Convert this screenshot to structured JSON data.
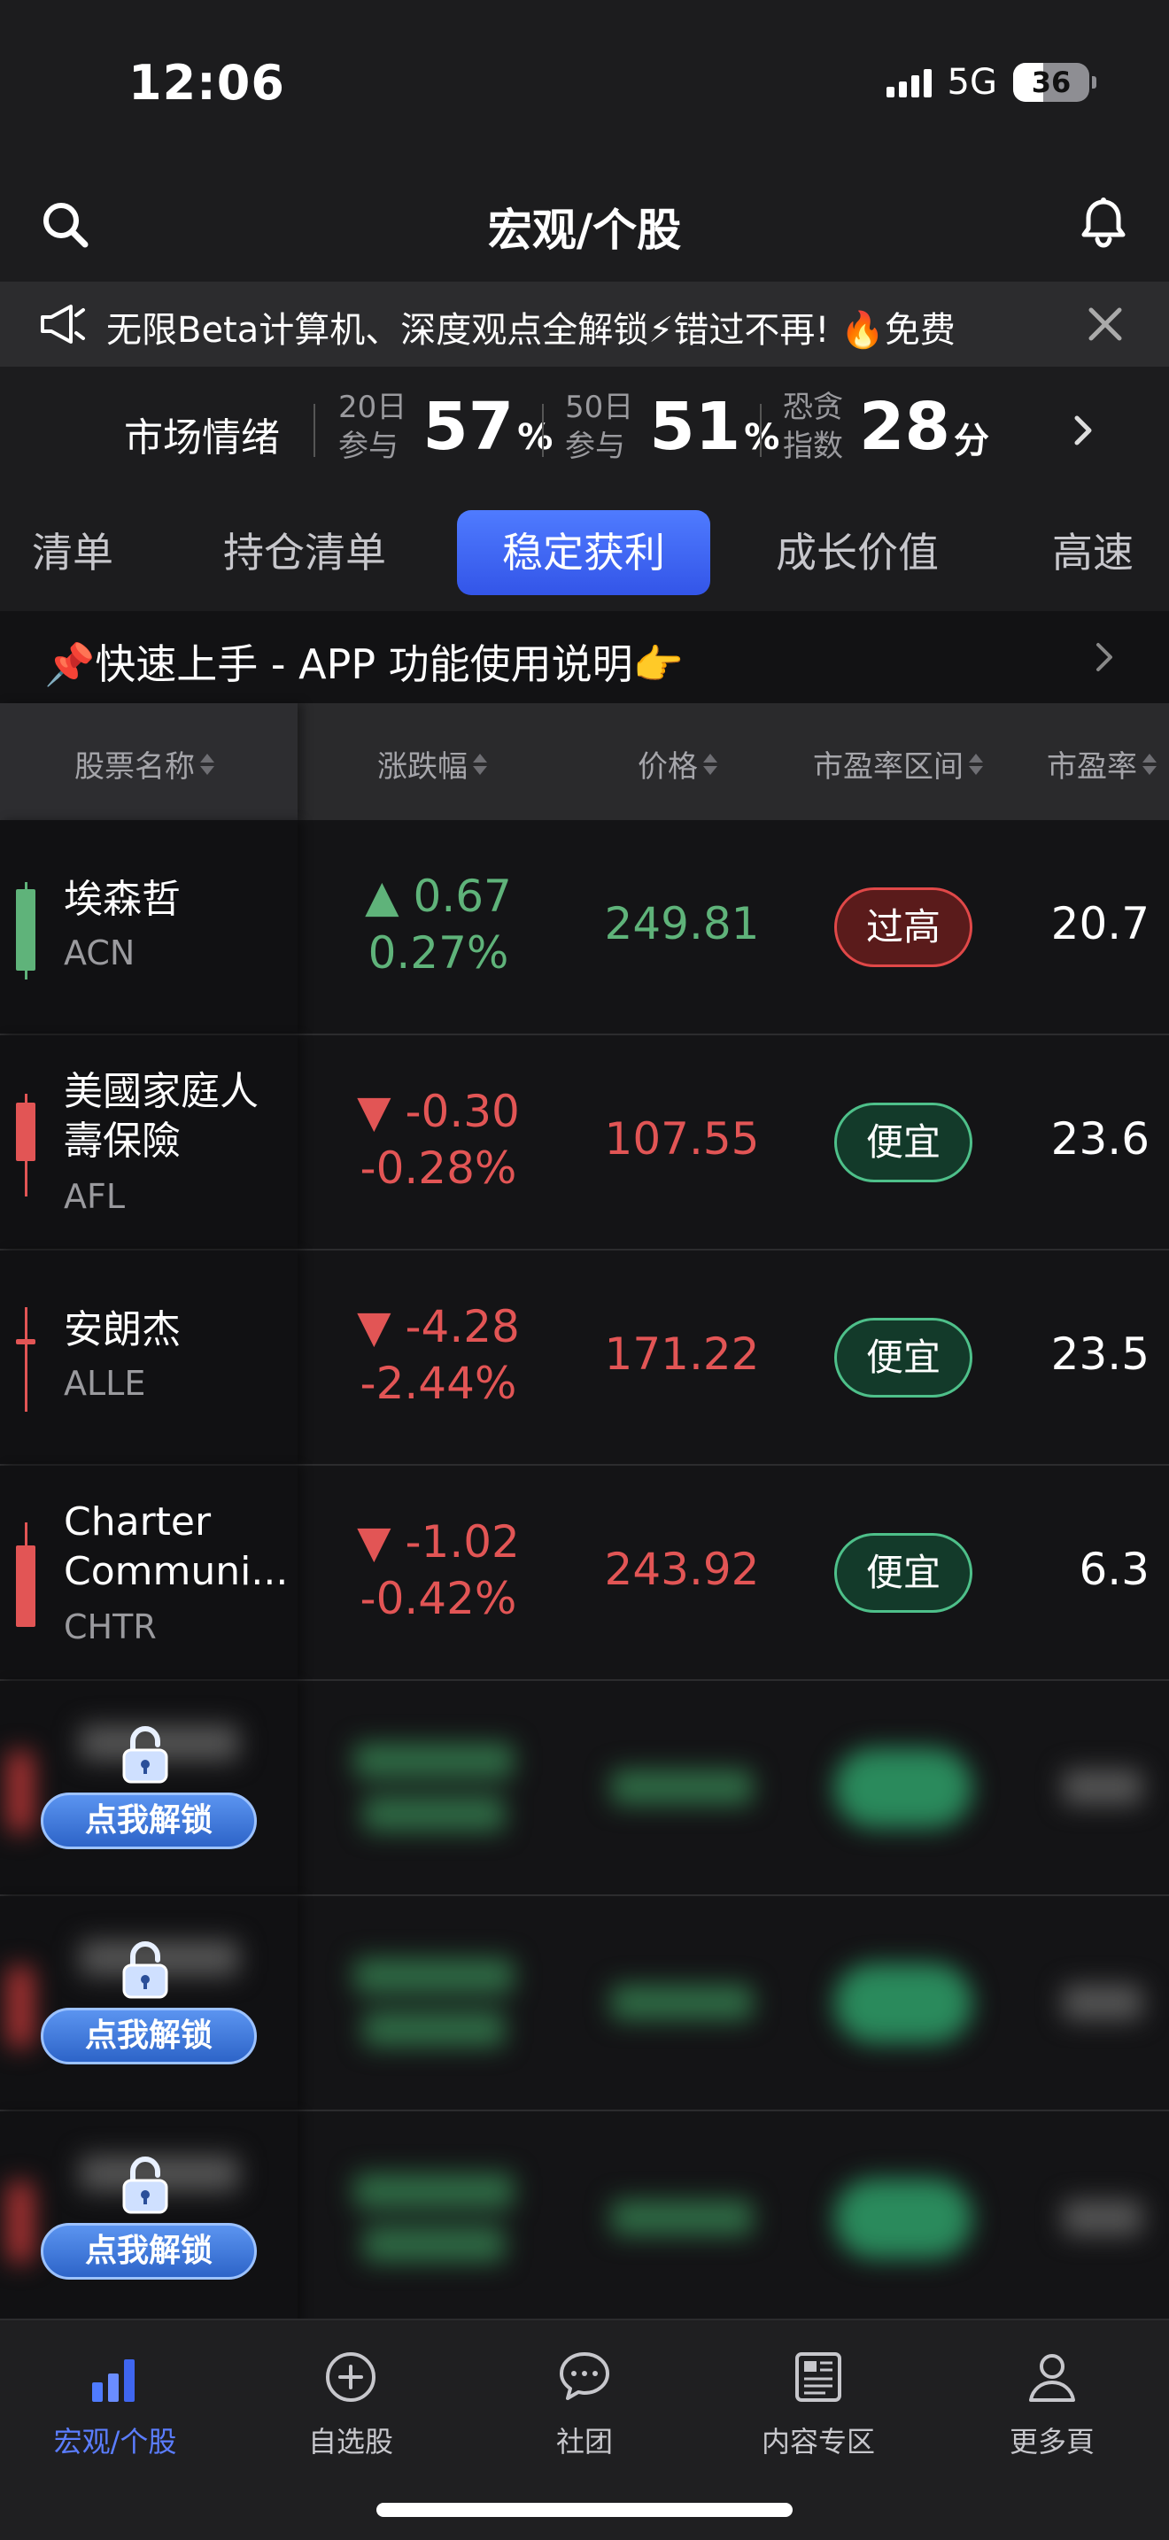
{
  "status": {
    "time": "12:06",
    "network": "5G",
    "battery": "36"
  },
  "header": {
    "title": "宏观/个股"
  },
  "announcement": {
    "text": "无限Beta计算机、深度观点全解锁⚡错过不再! 🔥免费"
  },
  "sentiment": {
    "title": "市场情绪",
    "day20_label_top": "20日",
    "day20_label_bottom": "参与",
    "day20_value": "57",
    "day20_unit": "%",
    "day50_label_top": "50日",
    "day50_label_bottom": "参与",
    "day50_value": "51",
    "day50_unit": "%",
    "fear_label_top": "恐贪",
    "fear_label_bottom": "指数",
    "fear_value": "28",
    "fear_unit": "分"
  },
  "tabs": [
    {
      "label": "清单"
    },
    {
      "label": "持仓清单"
    },
    {
      "label": "稳定获利",
      "active": true
    },
    {
      "label": "成长价值"
    },
    {
      "label": "高速"
    }
  ],
  "guide": {
    "text": "📌快速上手 - APP 功能使用说明👉"
  },
  "table": {
    "headers": [
      "股票名称",
      "涨跌幅",
      "价格",
      "市盈率区间",
      "市盈率"
    ],
    "rows": [
      {
        "name": "埃森哲",
        "code": "ACN",
        "change": "▲ 0.67",
        "pct": "0.27%",
        "price": "249.81",
        "range": "过高",
        "pe": "20.7",
        "dir": "up"
      },
      {
        "name": "美國家庭人壽保險",
        "code": "AFL",
        "change": "▼ -0.30",
        "pct": "-0.28%",
        "price": "107.55",
        "range": "便宜",
        "pe": "23.6",
        "dir": "down"
      },
      {
        "name": "安朗杰",
        "code": "ALLE",
        "change": "▼ -4.28",
        "pct": "-2.44%",
        "price": "171.22",
        "range": "便宜",
        "pe": "23.5",
        "dir": "down"
      },
      {
        "name": "Charter Communi...",
        "code": "CHTR",
        "change": "▼ -1.02",
        "pct": "-0.42%",
        "price": "243.92",
        "range": "便宜",
        "pe": "6.3",
        "dir": "down"
      }
    ],
    "unlock_label": "点我解锁"
  },
  "tabbar": [
    {
      "label": "宏观/个股",
      "active": true
    },
    {
      "label": "自选股"
    },
    {
      "label": "社团"
    },
    {
      "label": "内容专区"
    },
    {
      "label": "更多頁"
    }
  ],
  "colors": {
    "up": "#5fb37a",
    "down": "#e25555",
    "accent": "#4f7bff"
  }
}
